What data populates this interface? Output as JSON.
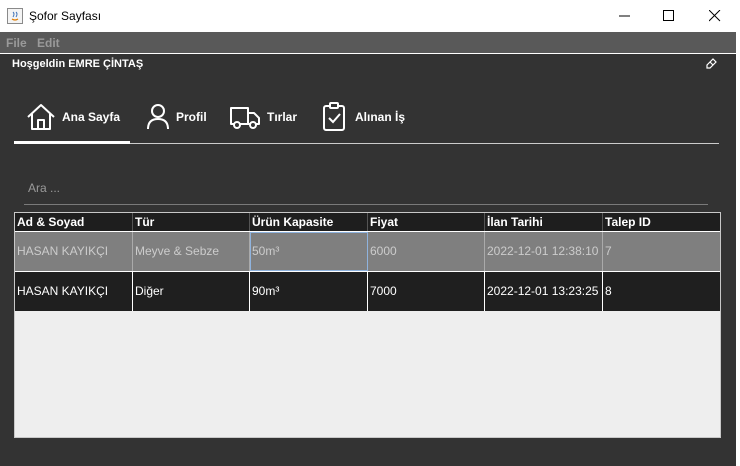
{
  "window": {
    "title": "Şofor Sayfası"
  },
  "menubar": {
    "items": [
      "File",
      "Edit"
    ]
  },
  "welcome_text": "Hoşgeldin EMRE ÇİNTAŞ",
  "tabs": [
    {
      "label": "Ana Sayfa",
      "icon": "home-icon",
      "active": true
    },
    {
      "label": "Profil",
      "icon": "user-icon",
      "active": false
    },
    {
      "label": "Tırlar",
      "icon": "truck-icon",
      "active": false
    },
    {
      "label": "Alınan İş",
      "icon": "clipboard-check-icon",
      "active": false
    }
  ],
  "search": {
    "placeholder": "Ara ..."
  },
  "table": {
    "columns": [
      "Ad & Soyad",
      "Tür",
      "Ürün Kapasite",
      "Fiyat",
      "İlan Tarihi",
      "Talep ID"
    ],
    "rows": [
      [
        "HASAN KAYIKÇI",
        "Meyve & Sebze",
        "50m³",
        "6000",
        "2022-12-01 12:38:10",
        "7"
      ],
      [
        "HASAN KAYIKÇI",
        "Diğer",
        "90m³",
        "7000",
        "2022-12-01 13:23:25",
        "8"
      ]
    ],
    "selected_row": 0
  },
  "colors": {
    "frame_bg": "#333333",
    "menubar_bg": "#595959",
    "header_bg": "#1e1e1e",
    "selected_row_bg": "#7f7f7f",
    "row_bg": "#1f1f1f",
    "table_empty_bg": "#eeeeee"
  }
}
